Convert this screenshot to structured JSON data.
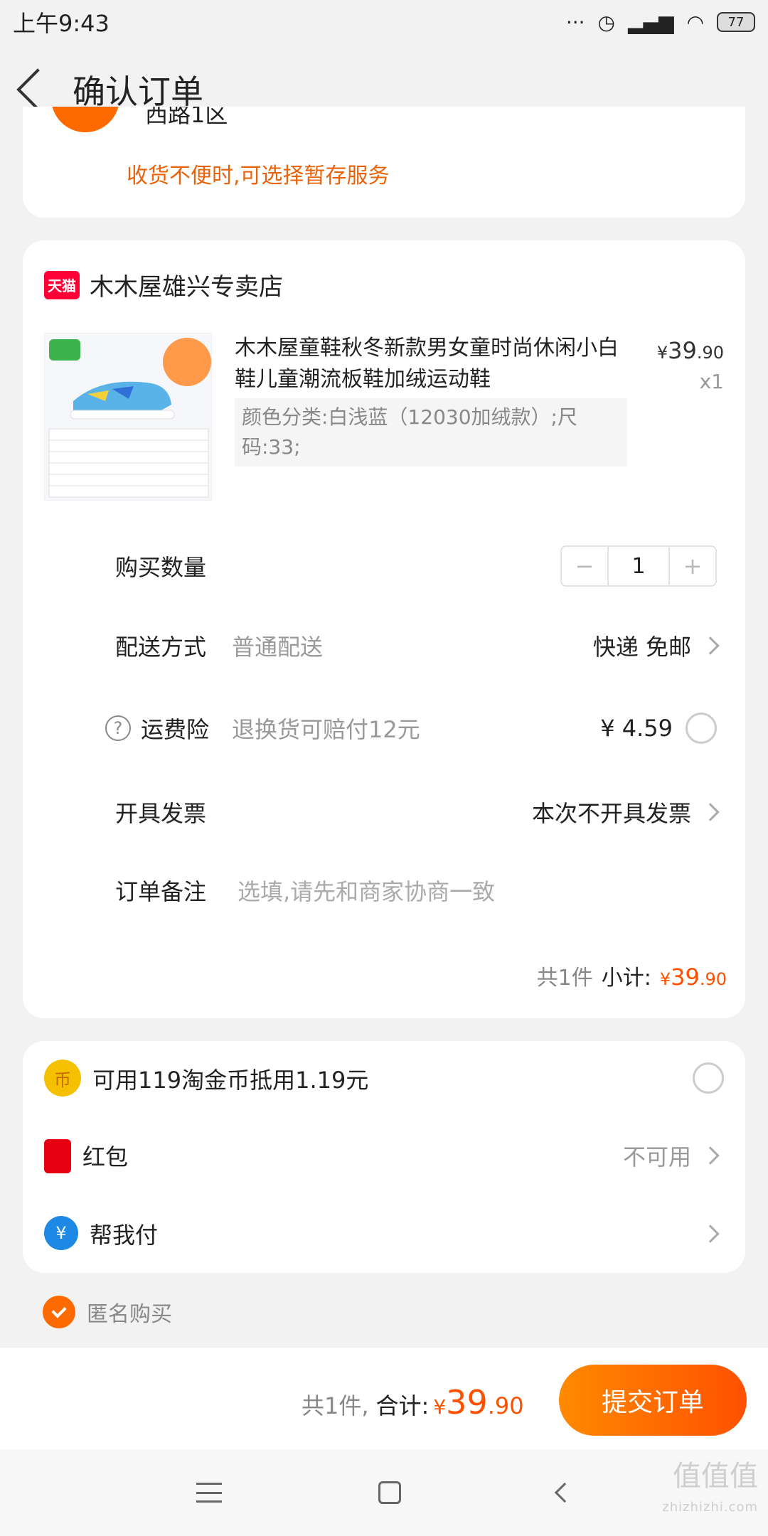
{
  "statusbar": {
    "time": "上午9:43",
    "battery": "77",
    "icons": [
      "dots-icon",
      "alarm-icon",
      "signal-icon",
      "wifi-icon",
      "battery-icon"
    ]
  },
  "nav": {
    "title": "确认订单"
  },
  "address": {
    "partial_line": "西路1区",
    "note": "收货不便时,可选择暂存服务"
  },
  "shop": {
    "badge": "天猫",
    "name": "木木屋雄兴专卖店"
  },
  "product": {
    "title": "木木屋童鞋秋冬新款男女童时尚休闲小白鞋儿童潮流板鞋加绒运动鞋",
    "price_currency": "¥",
    "price_int": "39",
    "price_dec": ".90",
    "quantity": "x1",
    "sku": "颜色分类:白浅蓝（12030加绒款）;尺码:33;"
  },
  "rows": {
    "quantity": {
      "label": "购买数量",
      "value": "1",
      "minus": "−",
      "plus": "+"
    },
    "delivery": {
      "label": "配送方式",
      "value": "普通配送",
      "right": "快递 免邮"
    },
    "insurance": {
      "label": "运费险",
      "value": "退换货可赔付12元",
      "right": "¥ 4.59",
      "help": "?"
    },
    "invoice": {
      "label": "开具发票",
      "right": "本次不开具发票"
    },
    "remark": {
      "label": "订单备注",
      "placeholder": "选填,请先和商家协商一致"
    }
  },
  "subtotal": {
    "count": "共1件",
    "label": "小计:",
    "currency": "¥",
    "int": "39",
    "dec": ".90"
  },
  "promos": {
    "coin": {
      "icon": "币",
      "text": "可用119淘金币抵用1.19元"
    },
    "redpacket": {
      "text": "红包",
      "right": "不可用"
    },
    "payforme": {
      "icon": "¥",
      "text": "帮我付"
    }
  },
  "anonymous": {
    "text": "匿名购买"
  },
  "footer": {
    "count": "共1件,",
    "label": "合计:",
    "currency": "¥",
    "int": "39",
    "dec": ".90",
    "submit": "提交订单"
  },
  "watermark": {
    "main": "值值值",
    "sub": "zhizhizhi.com"
  },
  "colors": {
    "accent": "#ff5000",
    "tmall": "#ff0036",
    "bg": "#f2f2f2"
  }
}
